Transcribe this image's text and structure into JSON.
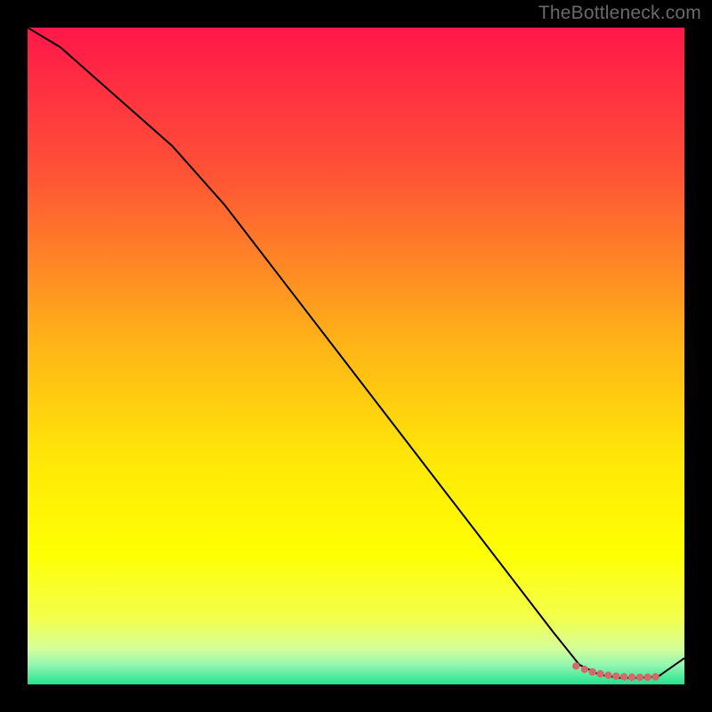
{
  "attribution": "TheBottleneck.com",
  "chart_data": {
    "type": "line",
    "title": "",
    "xlabel": "",
    "ylabel": "",
    "xlim": [
      0,
      100
    ],
    "ylim": [
      0,
      100
    ],
    "grid": false,
    "background": {
      "type": "vertical-gradient",
      "stops": [
        {
          "offset": 0.0,
          "color": "#ff1749"
        },
        {
          "offset": 0.22,
          "color": "#ff5236"
        },
        {
          "offset": 0.47,
          "color": "#ffb019"
        },
        {
          "offset": 0.66,
          "color": "#ffe807"
        },
        {
          "offset": 0.8,
          "color": "#feff02"
        },
        {
          "offset": 0.9,
          "color": "#f3ff4e"
        },
        {
          "offset": 0.945,
          "color": "#d6ff9a"
        },
        {
          "offset": 0.97,
          "color": "#94f7b1"
        },
        {
          "offset": 1.0,
          "color": "#23e28f"
        }
      ]
    },
    "series": [
      {
        "name": "bottleneck-curve",
        "color": "#000000",
        "width": 2,
        "x": [
          0,
          5,
          22,
          30,
          40,
          50,
          60,
          70,
          80,
          84,
          87,
          90,
          93,
          96,
          100
        ],
        "y": [
          100,
          97,
          82,
          73,
          60,
          47,
          34,
          21,
          8,
          3,
          1.5,
          1,
          1,
          1.2,
          4
        ]
      }
    ],
    "overlay_marks": {
      "name": "highlight-dots",
      "color": "#d2696b",
      "radius": 4.2,
      "points": [
        {
          "x": 83.5,
          "y": 2.8
        },
        {
          "x": 84.8,
          "y": 2.3
        },
        {
          "x": 86.0,
          "y": 1.9
        },
        {
          "x": 87.2,
          "y": 1.6
        },
        {
          "x": 88.4,
          "y": 1.4
        },
        {
          "x": 89.6,
          "y": 1.25
        },
        {
          "x": 90.8,
          "y": 1.15
        },
        {
          "x": 92.0,
          "y": 1.1
        },
        {
          "x": 93.2,
          "y": 1.08
        },
        {
          "x": 94.4,
          "y": 1.1
        },
        {
          "x": 95.6,
          "y": 1.15
        }
      ]
    }
  }
}
